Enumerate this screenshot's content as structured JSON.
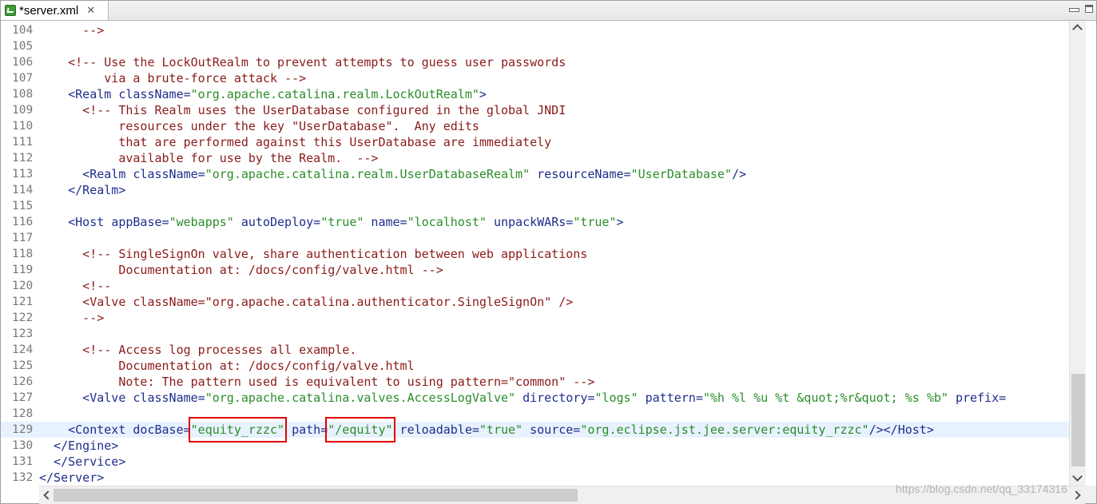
{
  "tab": {
    "title": "*server.xml",
    "close": "✕",
    "icon": "xml-file-icon"
  },
  "colors": {
    "comment": "#8b1a1a",
    "tag": "#1f2d8c",
    "value": "#2a8d2a",
    "highlight_line": "#e8f2fe",
    "annotation_box": "#e00000"
  },
  "lines": [
    {
      "n": "104",
      "segs": [
        [
          "c",
          "      -->"
        ]
      ]
    },
    {
      "n": "105",
      "segs": []
    },
    {
      "n": "106",
      "segs": [
        [
          "c",
          "    <!-- Use the LockOutRealm to prevent attempts to guess user passwords"
        ]
      ]
    },
    {
      "n": "107",
      "segs": [
        [
          "c",
          "         via a brute-force attack -->"
        ]
      ]
    },
    {
      "n": "108",
      "segs": [
        [
          "t",
          "    <Realm "
        ],
        [
          "a",
          "className="
        ],
        [
          "v",
          "\"org.apache.catalina.realm.LockOutRealm\""
        ],
        [
          "t",
          ">"
        ]
      ]
    },
    {
      "n": "109",
      "segs": [
        [
          "c",
          "      <!-- This Realm uses the UserDatabase configured in the global JNDI"
        ]
      ]
    },
    {
      "n": "110",
      "segs": [
        [
          "c",
          "           resources under the key \"UserDatabase\".  Any edits"
        ]
      ]
    },
    {
      "n": "111",
      "segs": [
        [
          "c",
          "           that are performed against this UserDatabase are immediately"
        ]
      ]
    },
    {
      "n": "112",
      "segs": [
        [
          "c",
          "           available for use by the Realm.  -->"
        ]
      ]
    },
    {
      "n": "113",
      "segs": [
        [
          "t",
          "      <Realm "
        ],
        [
          "a",
          "className="
        ],
        [
          "v",
          "\"org.apache.catalina.realm.UserDatabaseRealm\""
        ],
        [
          "a",
          " resourceName="
        ],
        [
          "v",
          "\"UserDatabase\""
        ],
        [
          "t",
          "/>"
        ]
      ]
    },
    {
      "n": "114",
      "segs": [
        [
          "t",
          "    </Realm>"
        ]
      ]
    },
    {
      "n": "115",
      "segs": []
    },
    {
      "n": "116",
      "segs": [
        [
          "t",
          "    <Host "
        ],
        [
          "a",
          "appBase="
        ],
        [
          "v",
          "\"webapps\""
        ],
        [
          "a",
          " autoDeploy="
        ],
        [
          "v",
          "\"true\""
        ],
        [
          "a",
          " name="
        ],
        [
          "v",
          "\"localhost\""
        ],
        [
          "a",
          " unpackWARs="
        ],
        [
          "v",
          "\"true\""
        ],
        [
          "t",
          ">"
        ]
      ]
    },
    {
      "n": "117",
      "segs": []
    },
    {
      "n": "118",
      "segs": [
        [
          "c",
          "      <!-- SingleSignOn valve, share authentication between web applications"
        ]
      ]
    },
    {
      "n": "119",
      "segs": [
        [
          "c",
          "           Documentation at: /docs/config/valve.html -->"
        ]
      ]
    },
    {
      "n": "120",
      "segs": [
        [
          "c",
          "      <!--"
        ]
      ]
    },
    {
      "n": "121",
      "segs": [
        [
          "c",
          "      <Valve className=\"org.apache.catalina.authenticator.SingleSignOn\" />"
        ]
      ]
    },
    {
      "n": "122",
      "segs": [
        [
          "c",
          "      -->"
        ]
      ]
    },
    {
      "n": "123",
      "segs": []
    },
    {
      "n": "124",
      "segs": [
        [
          "c",
          "      <!-- Access log processes all example."
        ]
      ]
    },
    {
      "n": "125",
      "segs": [
        [
          "c",
          "           Documentation at: /docs/config/valve.html"
        ]
      ]
    },
    {
      "n": "126",
      "segs": [
        [
          "c",
          "           Note: The pattern used is equivalent to using pattern=\"common\" -->"
        ]
      ]
    },
    {
      "n": "127",
      "segs": [
        [
          "t",
          "      <Valve "
        ],
        [
          "a",
          "className="
        ],
        [
          "v",
          "\"org.apache.catalina.valves.AccessLogValve\""
        ],
        [
          "a",
          " directory="
        ],
        [
          "v",
          "\"logs\""
        ],
        [
          "a",
          " pattern="
        ],
        [
          "v",
          "\"%h %l %u %t &quot;%r&quot; %s %b\""
        ],
        [
          "t",
          " "
        ],
        [
          "a",
          "prefix="
        ]
      ]
    },
    {
      "n": "128",
      "segs": []
    },
    {
      "n": "129",
      "current": true,
      "segs": [
        [
          "t",
          "    <Context "
        ],
        [
          "a",
          "docBase="
        ],
        [
          "v",
          "\"equity_rzzc\""
        ],
        [
          "a",
          " path="
        ],
        [
          "v",
          "\"/equity\""
        ],
        [
          "a",
          " reloadable="
        ],
        [
          "v",
          "\"true\""
        ],
        [
          "a",
          " source="
        ],
        [
          "v",
          "\"org.eclipse.jst.jee.server:equity_rzzc\""
        ],
        [
          "t",
          "/></Host>"
        ]
      ]
    },
    {
      "n": "130",
      "segs": [
        [
          "t",
          "  </Engine>"
        ]
      ]
    },
    {
      "n": "131",
      "segs": [
        [
          "t",
          "  </Service>"
        ]
      ]
    },
    {
      "n": "132",
      "segs": [
        [
          "t",
          "</Server>"
        ]
      ]
    }
  ],
  "annotations": [
    {
      "label": "docBase value",
      "text": "\"equity_rzzc\""
    },
    {
      "label": "path value",
      "text": "\"/equity\""
    }
  ],
  "watermark": "https://blog.csdn.net/qq_33174316"
}
